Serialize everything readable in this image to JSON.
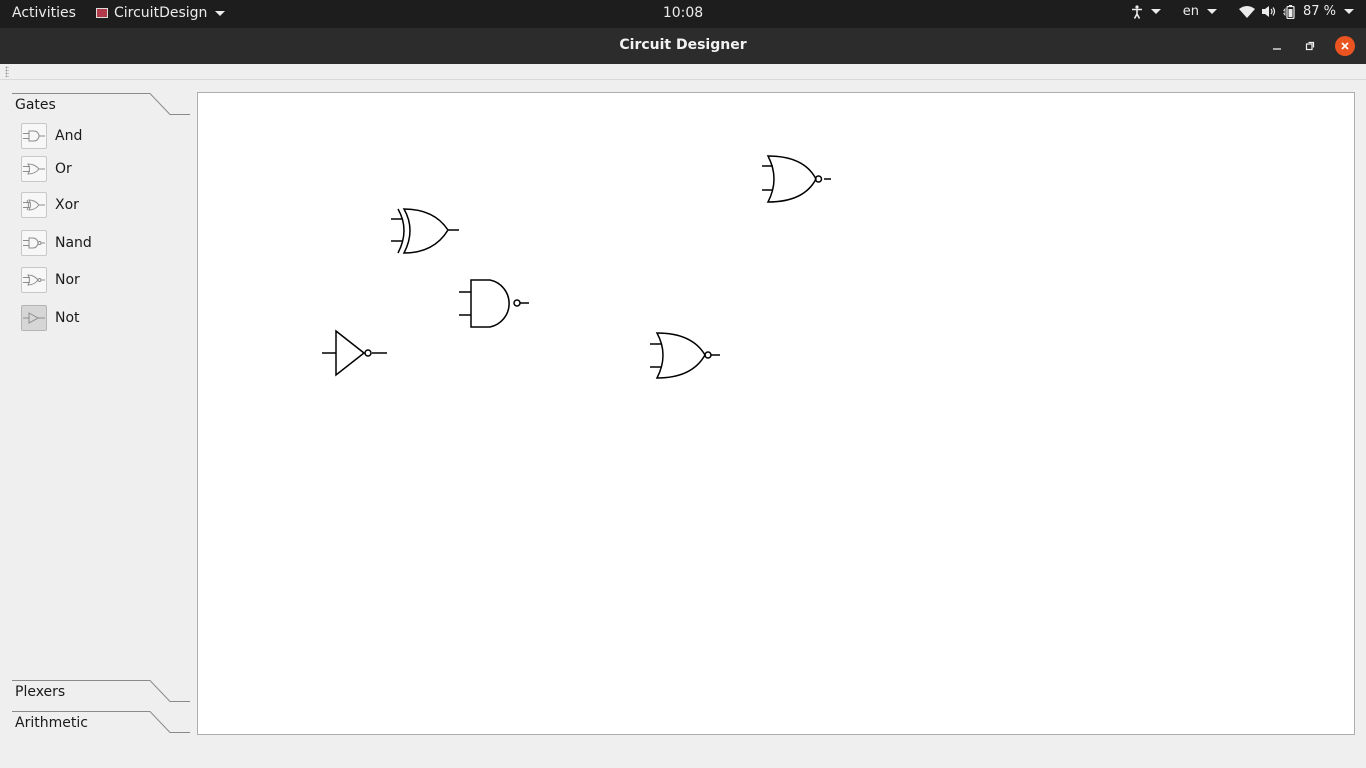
{
  "topbar": {
    "activities": "Activities",
    "app_name": "CircuitDesign",
    "clock": "10:08",
    "language": "en",
    "battery": "87 %"
  },
  "window": {
    "title": "Circuit Designer"
  },
  "panel": {
    "sections": [
      {
        "label": "Gates",
        "items": [
          {
            "label": "And"
          },
          {
            "label": "Or"
          },
          {
            "label": "Xor"
          },
          {
            "label": "Nand"
          },
          {
            "label": "Nor"
          },
          {
            "label": "Not",
            "selected": true
          }
        ]
      },
      {
        "label": "Plexers"
      },
      {
        "label": "Arithmetic"
      }
    ]
  },
  "canvas": {
    "gates": [
      {
        "type": "nor"
      },
      {
        "type": "xor"
      },
      {
        "type": "nand"
      },
      {
        "type": "not"
      },
      {
        "type": "nor"
      }
    ]
  },
  "colors": {
    "topbar": "#1d1d1d",
    "titlebar": "#2c2c2c",
    "close_button": "#e95420",
    "canvas_bg": "#ffffff"
  }
}
